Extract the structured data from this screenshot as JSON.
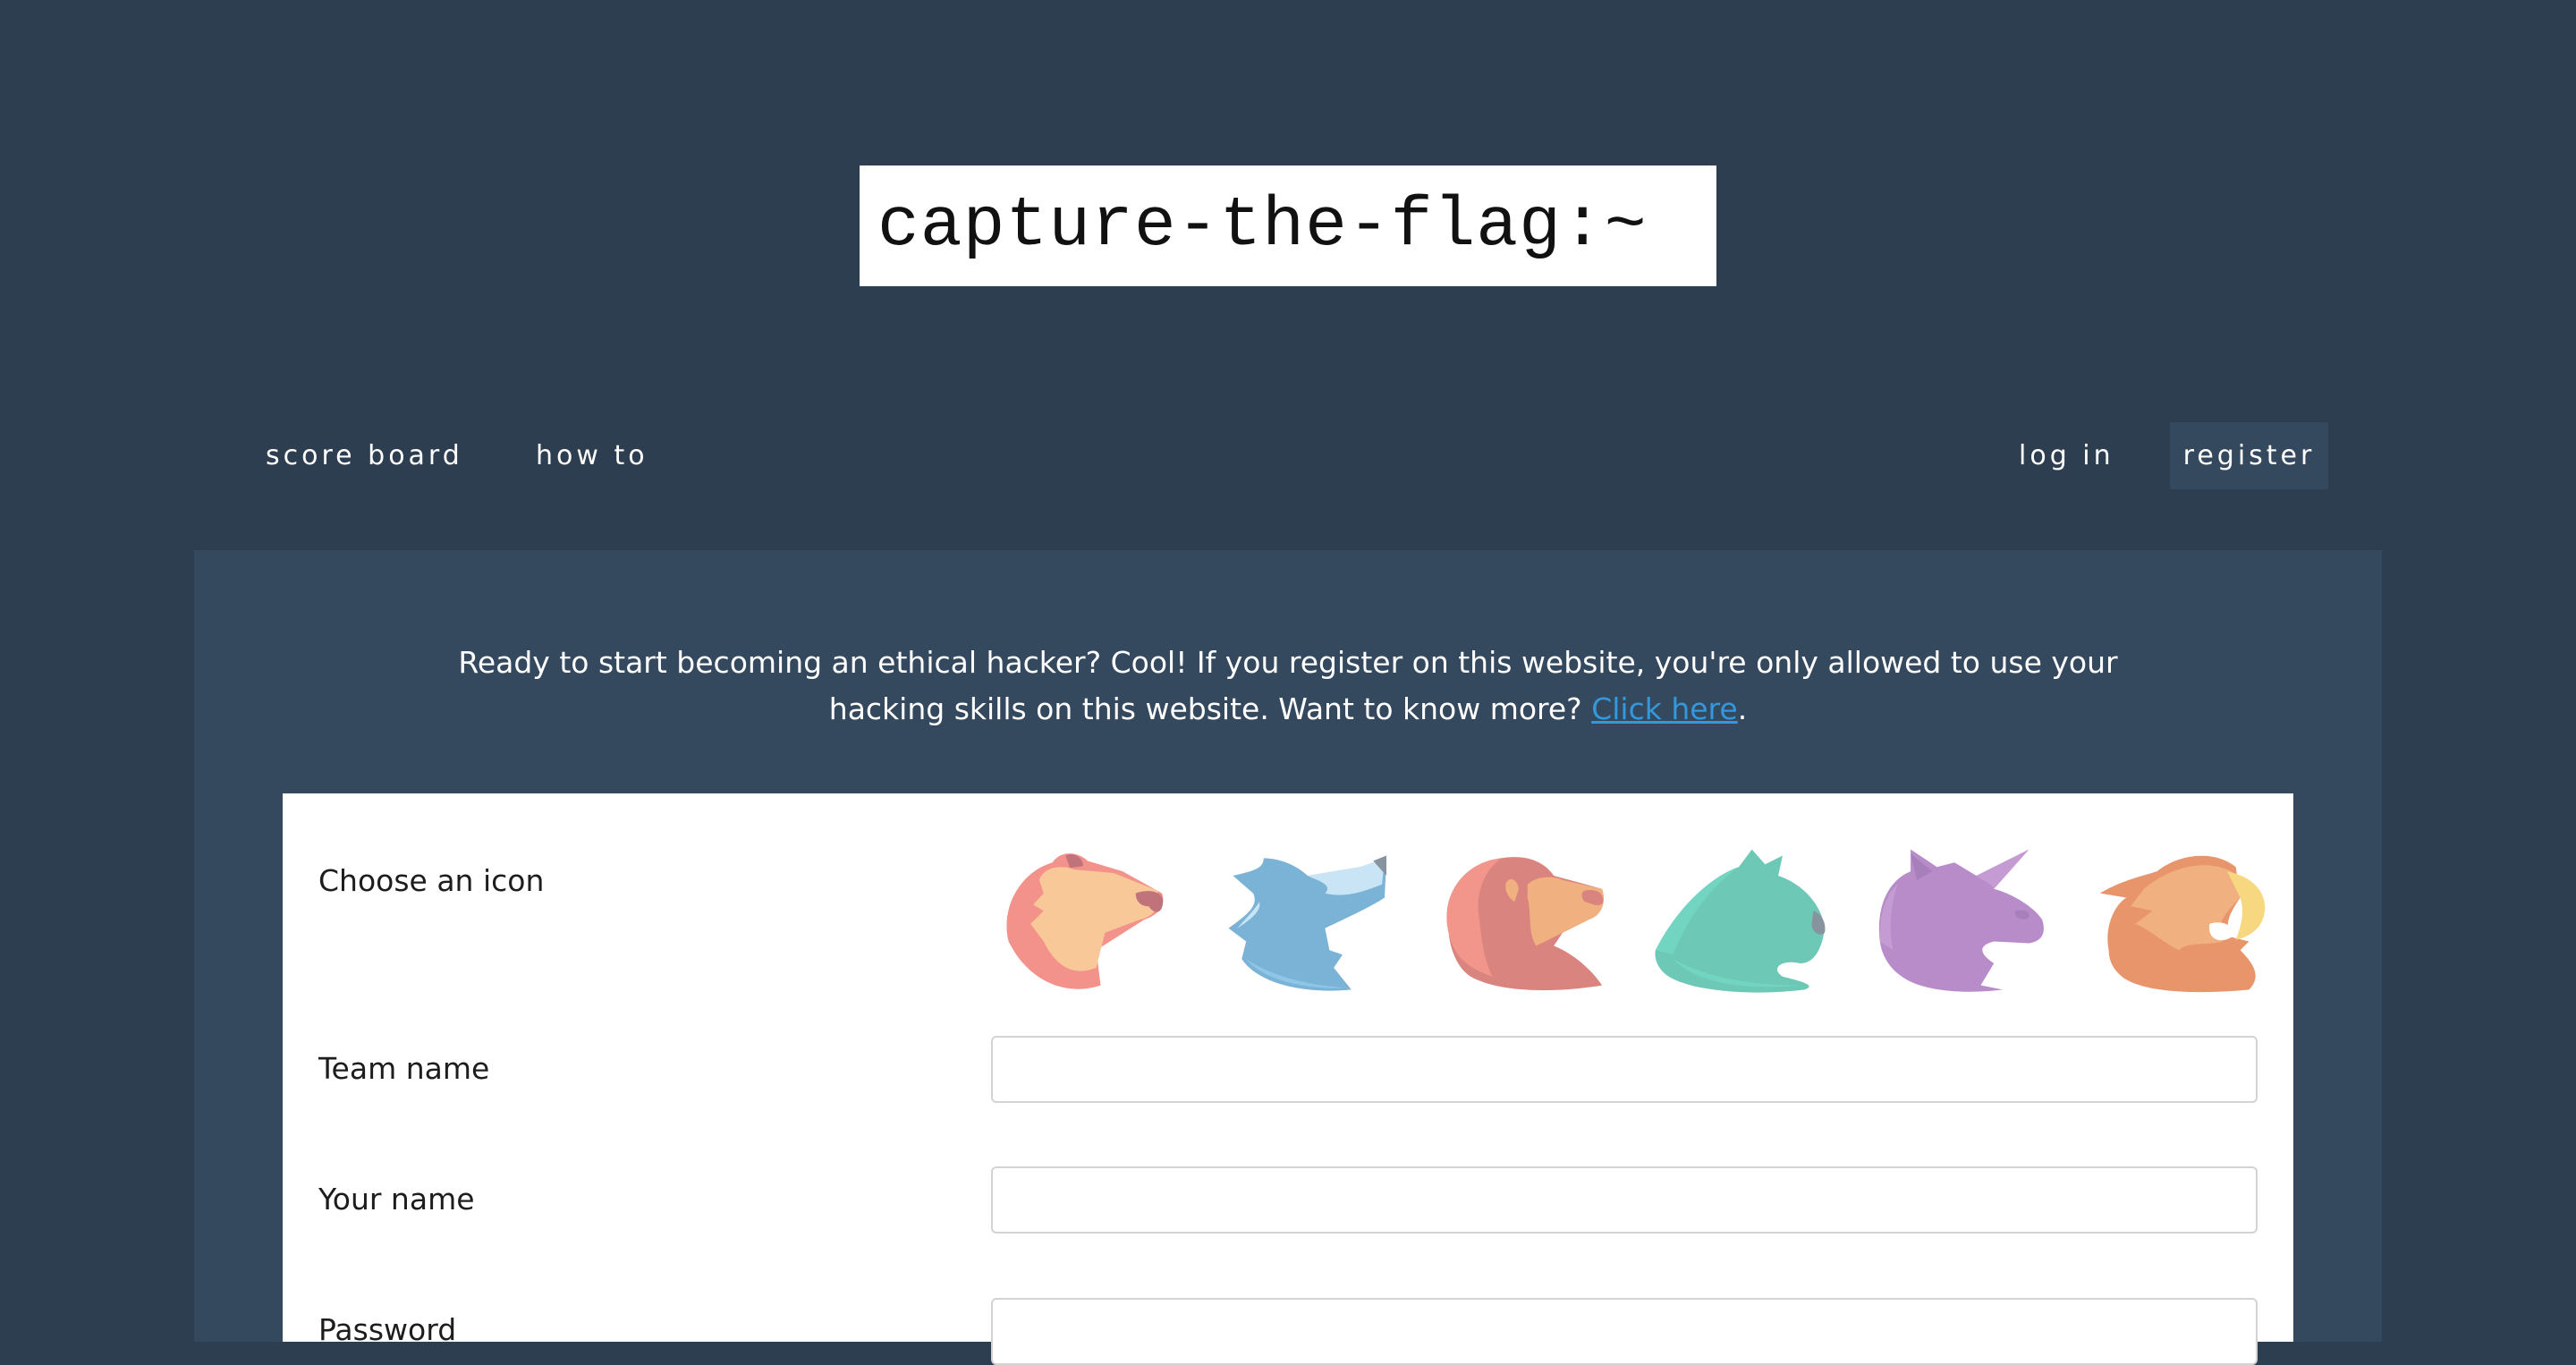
{
  "header": {
    "title": "capture-the-flag:~"
  },
  "nav": {
    "left": [
      {
        "label": "score board"
      },
      {
        "label": "how to"
      }
    ],
    "right": [
      {
        "label": "log in"
      },
      {
        "label": "register",
        "active": true
      }
    ]
  },
  "intro": {
    "text": "Ready to start becoming an ethical hacker? Cool! If you register on this website, you're only allowed to use your hacking skills on this website. Want to know more? ",
    "link_label": "Click here",
    "suffix": ".",
    "link_color": "#3498db"
  },
  "form": {
    "icon_label": "Choose an icon",
    "icons": [
      {
        "name": "bear",
        "colors": [
          "#f2928a",
          "#f8c898",
          "#c0737a"
        ]
      },
      {
        "name": "wolf",
        "colors": [
          "#7ab3d6",
          "#c9e4f5",
          "#8893a0"
        ]
      },
      {
        "name": "lion",
        "colors": [
          "#d9847f",
          "#f0b080",
          "#f2968c"
        ]
      },
      {
        "name": "panther",
        "colors": [
          "#6ec8b6",
          "#72d5c2",
          "#8893a0"
        ]
      },
      {
        "name": "unicorn",
        "colors": [
          "#b88bc9",
          "#c59bd3",
          "#a77fba"
        ]
      },
      {
        "name": "eagle",
        "colors": [
          "#e8956c",
          "#f0b080",
          "#f7d780"
        ]
      }
    ],
    "fields": [
      {
        "label": "Team name",
        "value": "",
        "placeholder": ""
      },
      {
        "label": "Your name",
        "value": "",
        "placeholder": ""
      },
      {
        "label": "Password",
        "value": "",
        "placeholder": ""
      }
    ]
  },
  "colors": {
    "page_bg": "#2e3e51",
    "panel_bg": "#34495e",
    "card_bg": "#ffffff"
  }
}
